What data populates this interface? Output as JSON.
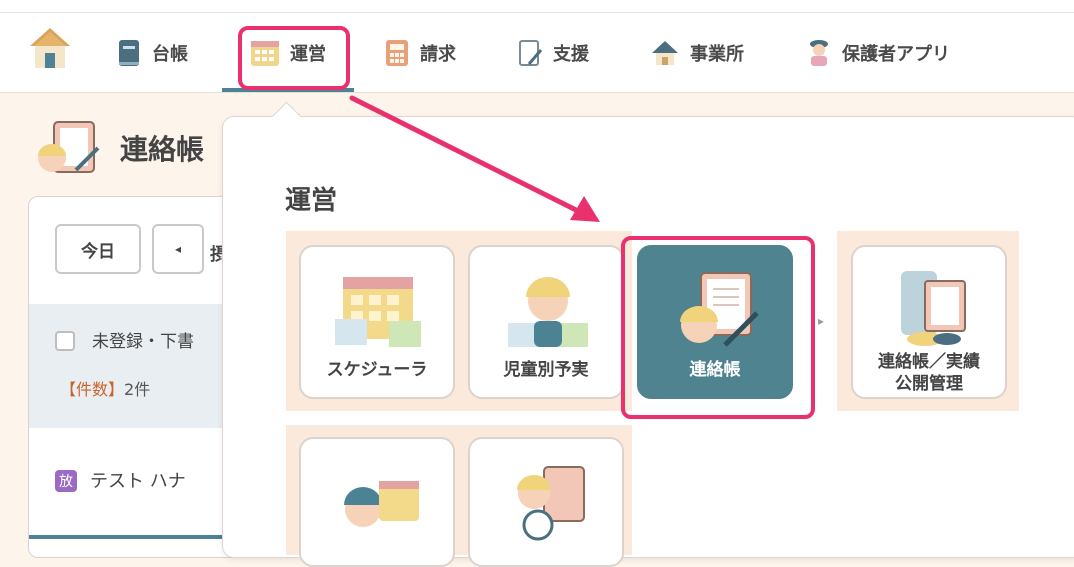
{
  "nav": {
    "items": [
      {
        "id": "home",
        "label": "",
        "icon": "home-icon"
      },
      {
        "id": "ledger",
        "label": "台帳",
        "icon": "ledger-icon"
      },
      {
        "id": "operation",
        "label": "運営",
        "icon": "calendar-icon"
      },
      {
        "id": "billing",
        "label": "請求",
        "icon": "calculator-icon"
      },
      {
        "id": "support",
        "label": "支援",
        "icon": "clipboard-pen-icon"
      },
      {
        "id": "office",
        "label": "事業所",
        "icon": "house-icon"
      },
      {
        "id": "guardian_app",
        "label": "保護者アプリ",
        "icon": "guardian-icon"
      }
    ],
    "active": "運営"
  },
  "page": {
    "title": "連絡帳",
    "today_button": "今日",
    "prev_button": "◂",
    "third_button_cut": "摂",
    "filter_label": "未登録・下書",
    "count_key": "【件数】",
    "count_value": "2件",
    "child_badge": "放",
    "child_name": "テスト ハナ"
  },
  "dropdown": {
    "heading": "運営",
    "tiles": [
      {
        "label": "スケジューラ",
        "icon": "scheduler-icon"
      },
      {
        "label": "児童別予実",
        "icon": "child-plan-icon"
      },
      {
        "label": "連絡帳",
        "icon": "contact-book-icon",
        "active": true
      },
      {
        "label_line1": "連絡帳／実績",
        "label_line2": "公開管理",
        "icon": "publish-management-icon"
      },
      {
        "label": "",
        "icon": "staff-schedule-icon"
      },
      {
        "label": "",
        "icon": "attendance-clock-icon"
      }
    ]
  },
  "colors": {
    "accent": "#4f838f",
    "highlight": "#e8316d",
    "background": "#fdf4ec",
    "group_bg": "#fbe9dc"
  }
}
